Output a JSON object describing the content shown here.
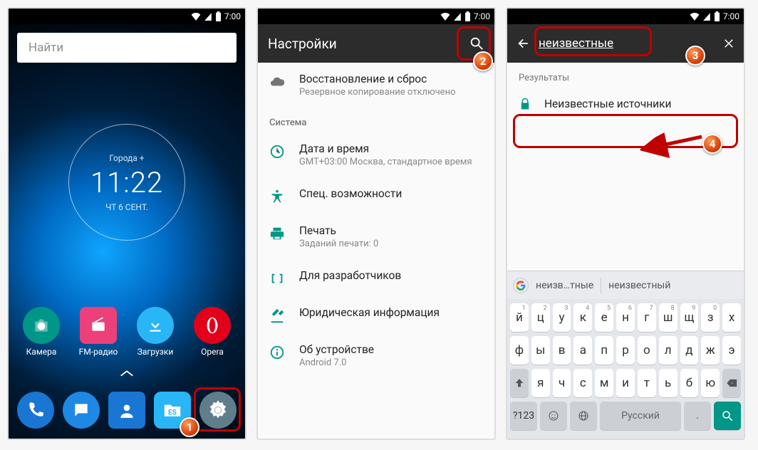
{
  "status": {
    "time": "7:00"
  },
  "screen1": {
    "search_placeholder": "Найти",
    "city": "Города +",
    "time": "11:22",
    "date": "чт 6 сент.",
    "apps": [
      {
        "name": "camera",
        "label": "Камера"
      },
      {
        "name": "fmradio",
        "label": "FM-радио"
      },
      {
        "name": "downloads",
        "label": "Загрузки"
      },
      {
        "name": "opera",
        "label": "Opera"
      }
    ],
    "dock": [
      {
        "name": "phone"
      },
      {
        "name": "messages"
      },
      {
        "name": "contacts"
      },
      {
        "name": "es-explorer"
      },
      {
        "name": "settings"
      }
    ]
  },
  "screen2": {
    "title": "Настройки",
    "top_item": {
      "title": "Восстановление и сброс",
      "subtitle": "Резервное копирование отключено"
    },
    "section": "Система",
    "items": [
      {
        "icon": "clock",
        "title": "Дата и время",
        "subtitle": "GMT+03:00 Москва, стандартное время"
      },
      {
        "icon": "a11y",
        "title": "Спец. возможности",
        "subtitle": ""
      },
      {
        "icon": "print",
        "title": "Печать",
        "subtitle": "Заданий печати: 0"
      },
      {
        "icon": "dev",
        "title": "Для разработчиков",
        "subtitle": ""
      },
      {
        "icon": "legal",
        "title": "Юридическая информация",
        "subtitle": ""
      },
      {
        "icon": "about",
        "title": "Об устройстве",
        "subtitle": "Android 7.0"
      }
    ]
  },
  "screen3": {
    "query": "неизвестные",
    "results_label": "Результаты",
    "result": "Неизвестные источники",
    "suggestions": [
      "неизв…тные",
      "неизвестный"
    ],
    "kbd": {
      "row1": [
        "й",
        "ц",
        "у",
        "к",
        "е",
        "н",
        "г",
        "ш",
        "щ",
        "з",
        "х"
      ],
      "row1nums": [
        "1",
        "2",
        "3",
        "4",
        "5",
        "6",
        "7",
        "8",
        "9",
        "0",
        ""
      ],
      "row2": [
        "ф",
        "ы",
        "в",
        "а",
        "п",
        "р",
        "о",
        "л",
        "д",
        "ж",
        "э"
      ],
      "row3": [
        "я",
        "ч",
        "с",
        "м",
        "и",
        "т",
        "ь",
        "б",
        "ю"
      ],
      "sym": "?123",
      "space": "Русский"
    }
  },
  "badges": {
    "b1": "1",
    "b2": "2",
    "b3": "3",
    "b4": "4"
  }
}
